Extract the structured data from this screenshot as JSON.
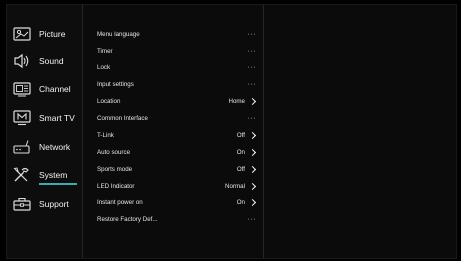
{
  "sidebar": {
    "items": [
      {
        "label": "Picture",
        "icon": "picture-icon"
      },
      {
        "label": "Sound",
        "icon": "speaker-icon"
      },
      {
        "label": "Channel",
        "icon": "channel-icon"
      },
      {
        "label": "Smart TV",
        "icon": "smart-tv-icon"
      },
      {
        "label": "Network",
        "icon": "network-icon"
      },
      {
        "label": "System",
        "icon": "tools-icon"
      },
      {
        "label": "Support",
        "icon": "toolbox-icon"
      }
    ],
    "selected": "System"
  },
  "settings": {
    "rows": [
      {
        "label": "Menu language",
        "value": "",
        "control": "dots"
      },
      {
        "label": "Timer",
        "value": "",
        "control": "dots"
      },
      {
        "label": "Lock",
        "value": "",
        "control": "dots"
      },
      {
        "label": "Input settings",
        "value": "",
        "control": "dots"
      },
      {
        "label": "Location",
        "value": "Home",
        "control": "chevron"
      },
      {
        "label": "Common Interface",
        "value": "",
        "control": "dots"
      },
      {
        "label": "T-Link",
        "value": "Off",
        "control": "chevron"
      },
      {
        "label": "Auto source",
        "value": "On",
        "control": "chevron"
      },
      {
        "label": "Sports mode",
        "value": "Off",
        "control": "chevron"
      },
      {
        "label": "LED Indicator",
        "value": "Normal",
        "control": "chevron"
      },
      {
        "label": "Instant power on",
        "value": "On",
        "control": "chevron"
      },
      {
        "label": "Restore Factory Def...",
        "value": "",
        "control": "dots"
      }
    ],
    "dots_text": "···"
  },
  "colors": {
    "background": "#000000",
    "accent": "#3da9b4",
    "text": "#ffffff"
  }
}
